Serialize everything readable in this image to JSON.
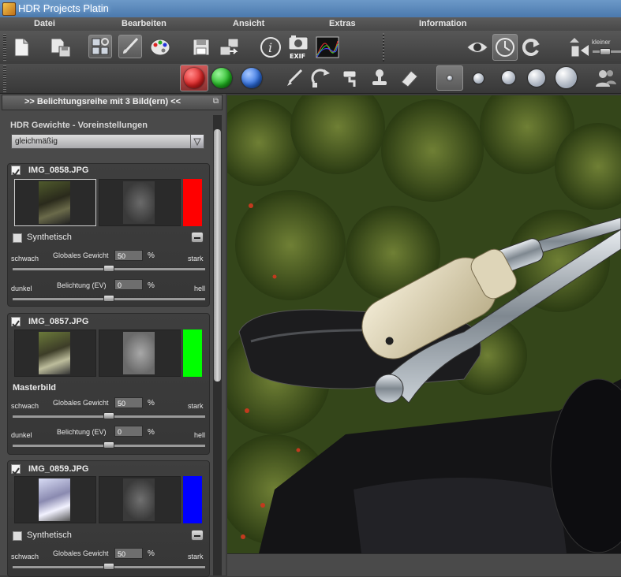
{
  "window": {
    "title": "HDR Projects Platin"
  },
  "menu": [
    "Datei",
    "Bearbeiten",
    "Ansicht",
    "Extras",
    "Information"
  ],
  "toolbar": {
    "zoom_label": "kleiner",
    "icons": [
      "new-document-icon",
      "save-as-icon",
      "layers-icon",
      "brush-icon",
      "palette-icon",
      "save-icon",
      "export-icon",
      "info-icon",
      "exif-camera-icon",
      "histogram-icon",
      "eye-icon",
      "auto-align-icon",
      "redo-icon",
      "zoom-out-icon"
    ],
    "exif_label": "EXIF",
    "colors": {
      "red": "#e02424",
      "green": "#22b822",
      "blue": "#2f6fe0"
    }
  },
  "panel": {
    "header": ">> Belichtungsreihe mit 3 Bild(ern) <<",
    "weights_title": "HDR Gewichte - Voreinstellungen",
    "preset_value": "gleichmäßig",
    "images": [
      {
        "name": "IMG_0858.JPG",
        "checked": true,
        "color": "#ff0000",
        "synthetic_label": "Synthetisch",
        "is_master": false,
        "weight": {
          "left": "schwach",
          "label": "Globales Gewicht",
          "value": "50",
          "unit": "%",
          "right": "stark",
          "level": 0.5
        },
        "exposure": {
          "left": "dunkel",
          "label": "Belichtung (EV)",
          "value": "0",
          "unit": "%",
          "right": "hell",
          "level": 0.5
        }
      },
      {
        "name": "IMG_0857.JPG",
        "checked": true,
        "color": "#00ff00",
        "master_label": "Masterbild",
        "is_master": true,
        "weight": {
          "left": "schwach",
          "label": "Globales Gewicht",
          "value": "50",
          "unit": "%",
          "right": "stark",
          "level": 0.5
        },
        "exposure": {
          "left": "dunkel",
          "label": "Belichtung (EV)",
          "value": "0",
          "unit": "%",
          "right": "hell",
          "level": 0.5
        }
      },
      {
        "name": "IMG_0859.JPG",
        "checked": true,
        "color": "#0000ff",
        "synthetic_label": "Synthetisch",
        "is_master": false,
        "weight": {
          "left": "schwach",
          "label": "Globales Gewicht",
          "value": "50",
          "unit": "%",
          "right": "stark",
          "level": 0.5
        }
      }
    ]
  }
}
